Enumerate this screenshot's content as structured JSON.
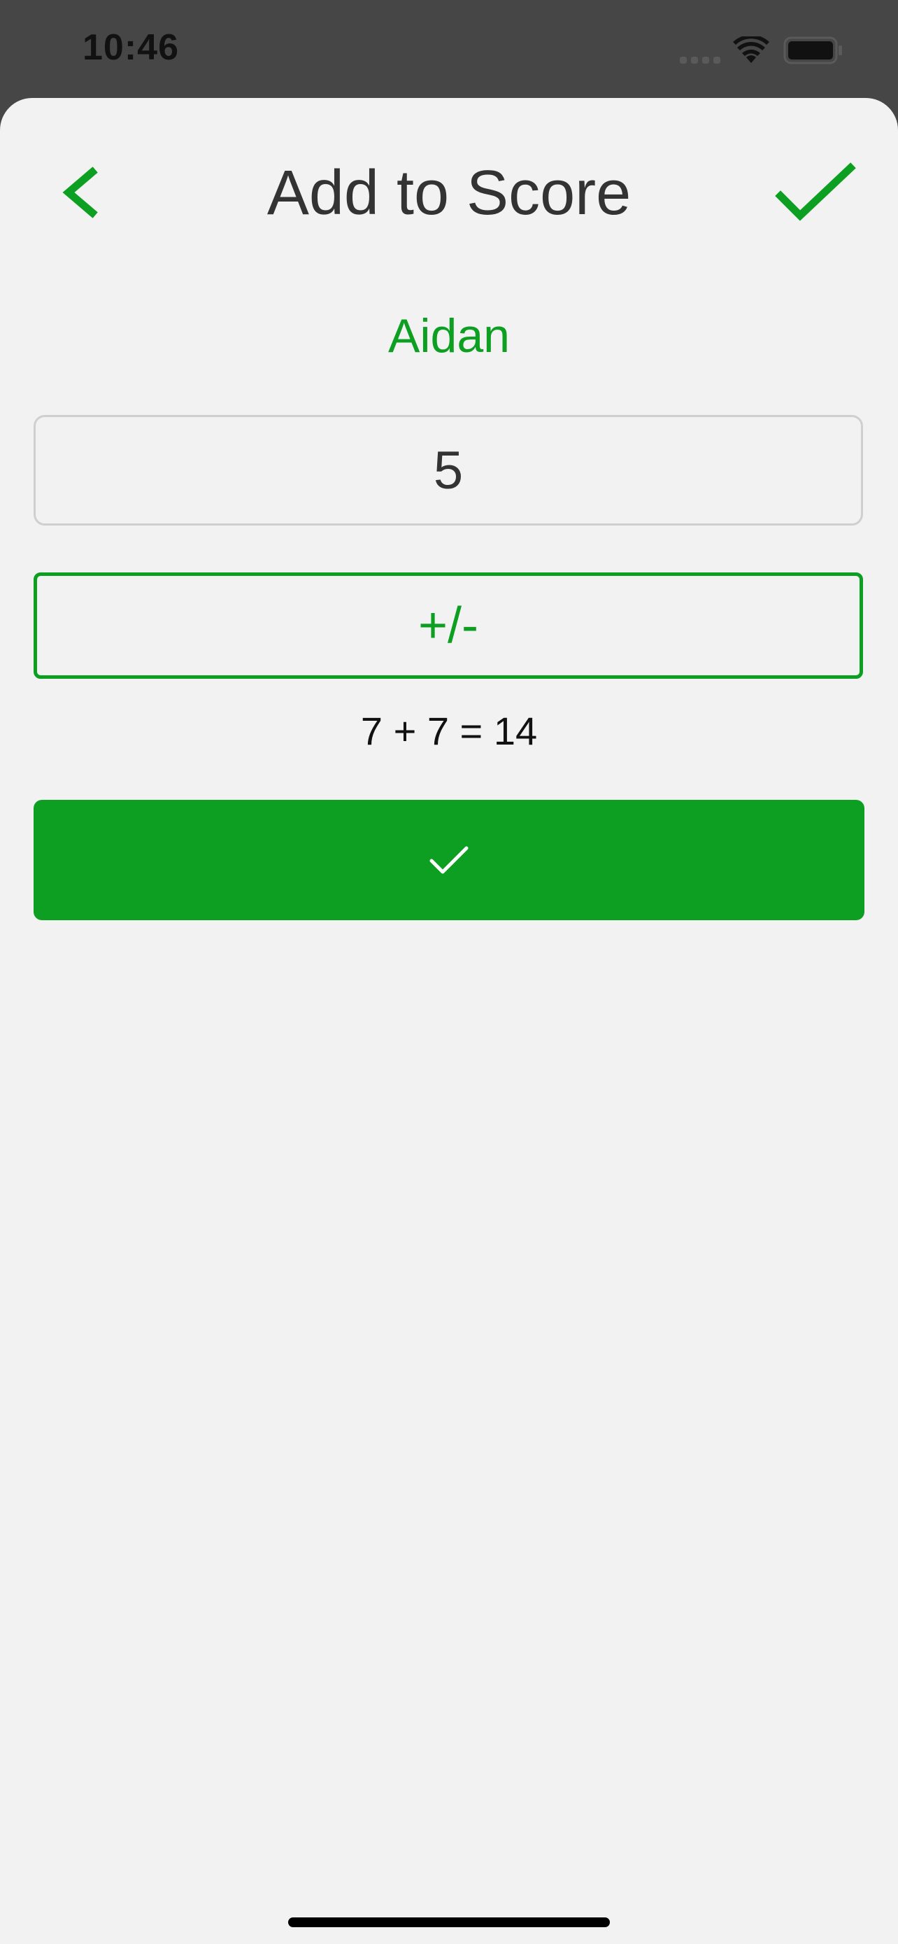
{
  "status_bar": {
    "time": "10:46"
  },
  "header": {
    "title": "Add to Score",
    "back_icon": "chevron-left-icon",
    "confirm_icon": "checkmark-icon"
  },
  "player": {
    "name": "Aidan"
  },
  "score_input": {
    "value": "5"
  },
  "sign_toggle": {
    "label": "+/-"
  },
  "equation": {
    "text": "7 + 7 = 14"
  },
  "submit": {
    "icon": "checkmark-icon"
  },
  "colors": {
    "accent": "#0c9f22",
    "background": "#f2f2f2",
    "status_bar": "#464646"
  }
}
